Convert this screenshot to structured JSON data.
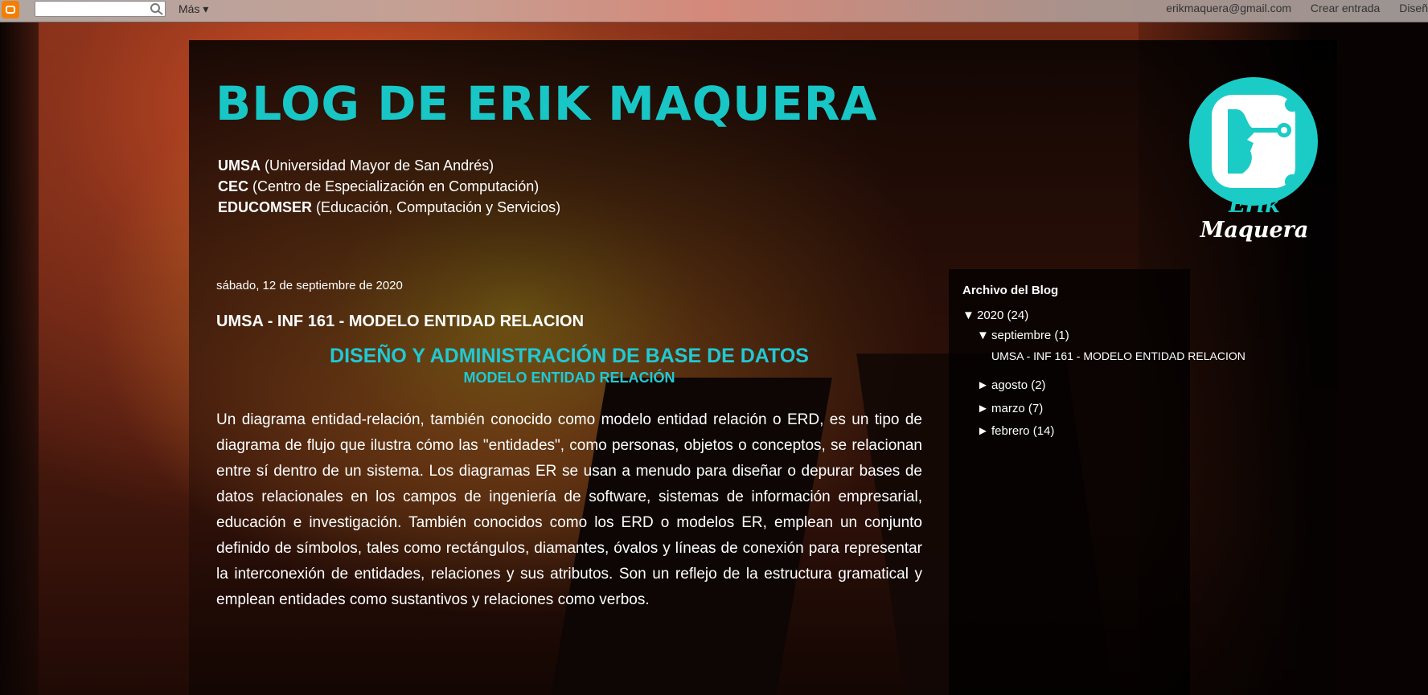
{
  "navbar": {
    "more_label": "Más",
    "search_placeholder": "",
    "user_email": "erikmaquera@gmail.com",
    "create_post_label": "Crear entrada",
    "design_label": "Diseñ"
  },
  "header": {
    "title": "Blog de Erik Maquera",
    "description": [
      {
        "abbr": "UMSA",
        "full": "(Universidad Mayor de San Andrés)"
      },
      {
        "abbr": "CEC",
        "full": "(Centro de Especialización en Computación)"
      },
      {
        "abbr": "EDUCOMSER",
        "full": "(Educación, Computación y Servicios)"
      }
    ],
    "logo_name_first": "Erik",
    "logo_name_last": "Maquera"
  },
  "post": {
    "date": "sábado, 12 de septiembre de 2020",
    "title": "UMSA - INF 161 - MODELO ENTIDAD RELACION",
    "heading_main": "DISEÑO Y ADMINISTRACIÓN DE BASE DE DATOS",
    "heading_sub": "MODELO ENTIDAD RELACIÓN",
    "body": "Un diagrama entidad-relación, también conocido como modelo entidad relación o ERD, es un tipo de diagrama de flujo que ilustra cómo las \"entidades\", como personas, objetos o conceptos, se relacionan entre sí dentro de un sistema. Los diagramas ER se usan a menudo para diseñar o depurar bases de datos relacionales en los campos de ingeniería de software, sistemas de información empresarial, educación e investigación. También conocidos como los ERD o modelos ER, emplean un conjunto definido de símbolos, tales como rectángulos, diamantes, óvalos y líneas de conexión para representar la interconexión de entidades, relaciones y sus atributos. Son un reflejo de la estructura gramatical y emplean entidades como sustantivos y relaciones como verbos."
  },
  "sidebar": {
    "archive_title": "Archivo del Blog",
    "year": {
      "toggle": "▼",
      "label": "2020",
      "count": "(24)"
    },
    "months": [
      {
        "toggle": "▼",
        "label": "septiembre",
        "count": "(1)"
      },
      {
        "toggle": "►",
        "label": "agosto",
        "count": "(2)"
      },
      {
        "toggle": "►",
        "label": "marzo",
        "count": "(7)"
      },
      {
        "toggle": "►",
        "label": "febrero",
        "count": "(14)"
      }
    ],
    "september_post": "UMSA - INF 161 - MODELO ENTIDAD RELACION"
  },
  "colors": {
    "accent": "#18c6c6",
    "heading": "#20c9d4",
    "blogger_orange": "#f57d00"
  }
}
